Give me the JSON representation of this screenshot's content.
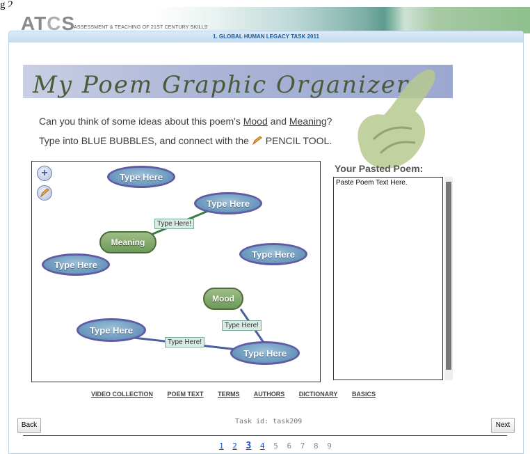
{
  "corner_label": "g 2",
  "header": {
    "logo": "ATCS",
    "tagline": "ASSESSMENT & TEACHING OF 21ST CENTURY SKILLS"
  },
  "task_bar": {
    "title": "1. GLOBAL HUMAN LEGACY TASK 2011"
  },
  "banner": {
    "title": "My Poem Graphic Organizer"
  },
  "prompt": {
    "line1_a": "Can you think of some ideas about this poem's ",
    "mood": "Mood",
    "line1_and": " and ",
    "meaning": "Meaning",
    "line1_end": "?",
    "line2_a": "Type into BLUE BUBBLES, and connect with the ",
    "line2_b": " PENCIL TOOL."
  },
  "organizer": {
    "tools": [
      {
        "name": "add-bubble",
        "icon": "plus-icon"
      },
      {
        "name": "pencil-tool",
        "icon": "pencil-icon"
      }
    ],
    "bubbles": [
      "Type Here",
      "Type Here",
      "Type Here",
      "Type Here",
      "Type Here",
      "Type Here"
    ],
    "nodes": [
      "Meaning",
      "Mood"
    ],
    "link_labels": [
      "Type Here!",
      "Type Here!",
      "Type Here!"
    ]
  },
  "poem": {
    "title": "Your Pasted Poem:",
    "placeholder": "Paste Poem Text Here."
  },
  "links": [
    "VIDEO COLLECTION",
    "POEM TEXT",
    "TERMS",
    "AUTHORS",
    "DICTIONARY",
    "BASICS"
  ],
  "footer": {
    "back": "Back",
    "next": "Next",
    "task_id": "Task id: task209"
  },
  "pager": [
    "1",
    "2",
    "3",
    "4",
    "5",
    "6",
    "7",
    "8",
    "9"
  ],
  "pager_current": "3",
  "colors": {
    "bubble_border": "#5f5ca4",
    "node_green": "#6e9a5a",
    "link_blue": "#1b4fbf"
  }
}
